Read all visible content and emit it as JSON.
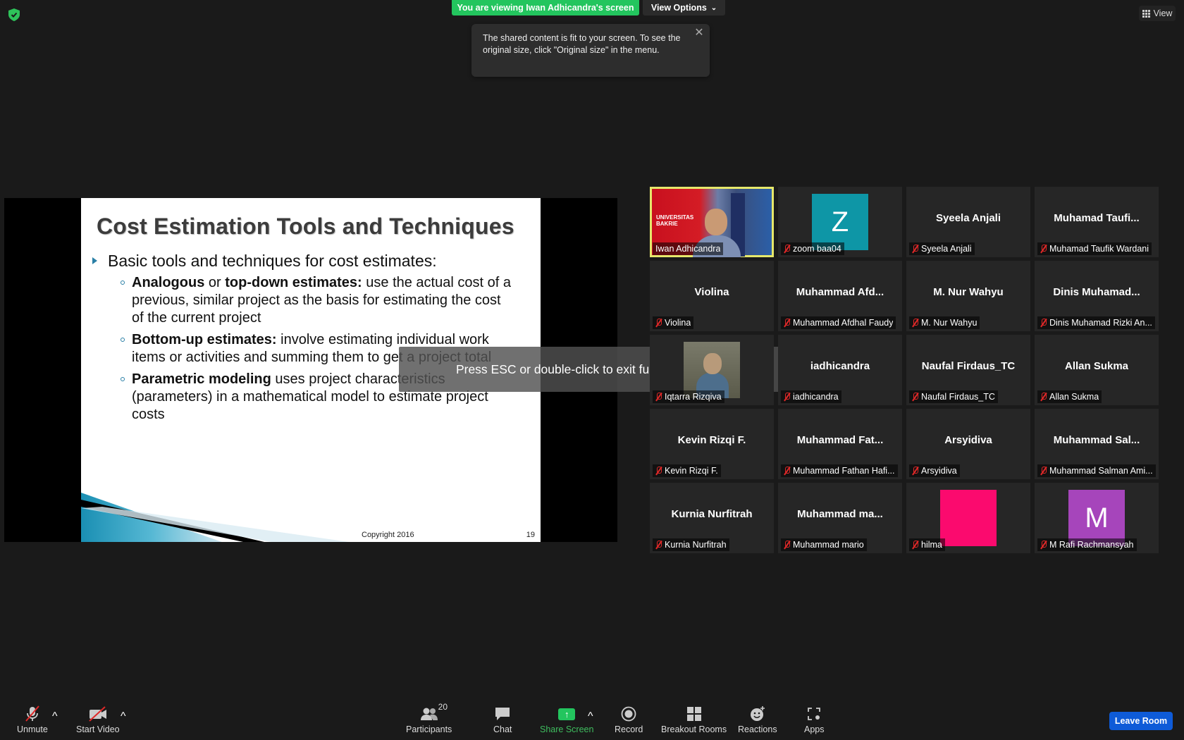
{
  "banner": {
    "viewing": "You are viewing Iwan Adhicandra's screen",
    "view_options": "View Options",
    "view": "View"
  },
  "tooltip": {
    "text": "The shared content is fit to your screen. To see the original size, click \"Original size\" in the menu."
  },
  "slide": {
    "title": "Cost Estimation Tools and Techniques",
    "bullet": "Basic tools and techniques for cost estimates:",
    "items": [
      {
        "bold1": "Analogous",
        "mid": " or ",
        "bold2": "top-down estimates:",
        "rest": " use the actual cost of a previous, similar project as the basis for estimating the cost of the current project"
      },
      {
        "bold1": "Bottom-up estimates:",
        "mid": "",
        "bold2": "",
        "rest": " involve estimating individual work items or activities and summing them to get a project total"
      },
      {
        "bold1": "Parametric modeling",
        "mid": "",
        "bold2": "",
        "rest": " uses project characteristics (parameters) in a mathematical model to estimate project costs"
      }
    ],
    "copyright": "Copyright 2016",
    "page": "19"
  },
  "esc_message": "Press ESC or double-click to exit full screen mode",
  "participants": [
    {
      "center": "",
      "label": "Iwan Adhicandra",
      "type": "video",
      "active": true
    },
    {
      "center": "Z",
      "label": "zoom baa04",
      "type": "avatar",
      "color": "#0e96a6"
    },
    {
      "center": "Syeela Anjali",
      "label": "Syeela Anjali",
      "type": "name"
    },
    {
      "center": "Muhamad  Taufi...",
      "label": "Muhamad Taufik Wardani",
      "type": "name"
    },
    {
      "center": "Violina",
      "label": "Violina",
      "type": "name"
    },
    {
      "center": "Muhammad  Afd...",
      "label": "Muhammad Afdhal Faudy",
      "type": "name"
    },
    {
      "center": "M. Nur Wahyu",
      "label": "M. Nur Wahyu",
      "type": "name"
    },
    {
      "center": "Dinis  Muhamad...",
      "label": "Dinis Muhamad Rizki An...",
      "type": "name"
    },
    {
      "center": "",
      "label": "Iqtarra Rizqiva",
      "type": "photo"
    },
    {
      "center": "iadhicandra",
      "label": "iadhicandra",
      "type": "name"
    },
    {
      "center": "Naufal Firdaus_TC",
      "label": "Naufal Firdaus_TC",
      "type": "name"
    },
    {
      "center": "Allan Sukma",
      "label": "Allan Sukma",
      "type": "name"
    },
    {
      "center": "Kevin Rizqi F.",
      "label": "Kevin Rizqi F.",
      "type": "name"
    },
    {
      "center": "Muhammad  Fat...",
      "label": "Muhammad Fathan Hafi...",
      "type": "name"
    },
    {
      "center": "Arsyidiva",
      "label": "Arsyidiva",
      "type": "name"
    },
    {
      "center": "Muhammad  Sal...",
      "label": "Muhammad Salman Ami...",
      "type": "name"
    },
    {
      "center": "Kurnia Nurfitrah",
      "label": "Kurnia Nurfitrah",
      "type": "name"
    },
    {
      "center": "Muhammad  ma...",
      "label": "Muhammad mario",
      "type": "name"
    },
    {
      "center": "",
      "label": "hilma",
      "type": "avatar",
      "color": "#fb0a6e"
    },
    {
      "center": "M",
      "label": "M Rafi Rachmansyah",
      "type": "avatar",
      "color": "#a645bb"
    }
  ],
  "video_tile": {
    "logo_line1": "UNIVERSITAS",
    "logo_line2": "BAKRIE"
  },
  "toolbar": {
    "unmute": "Unmute",
    "start_video": "Start Video",
    "participants": "Participants",
    "participant_count": "20",
    "chat": "Chat",
    "share_screen": "Share Screen",
    "record": "Record",
    "breakout_rooms": "Breakout Rooms",
    "reactions": "Reactions",
    "apps": "Apps",
    "leave_room": "Leave Room"
  }
}
